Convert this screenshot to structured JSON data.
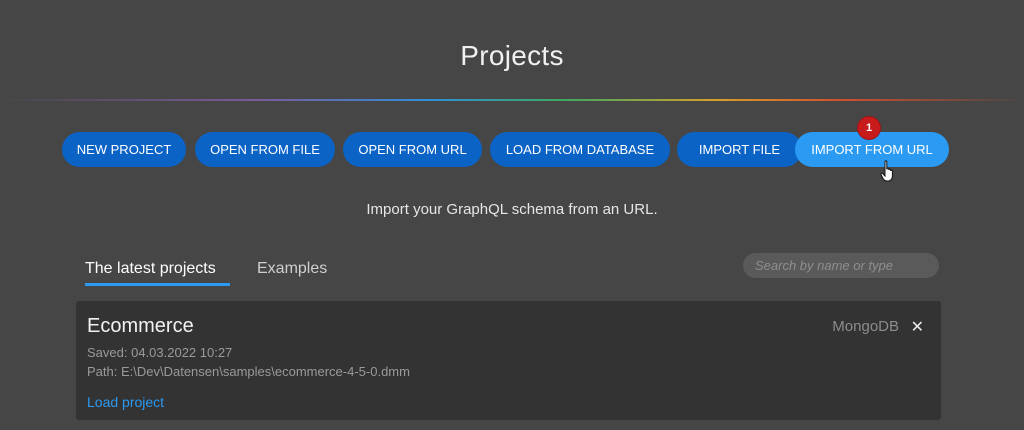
{
  "header": {
    "title": "Projects"
  },
  "toolbar": {
    "buttons": [
      {
        "label": "NEW PROJECT"
      },
      {
        "label": "OPEN FROM FILE"
      },
      {
        "label": "OPEN FROM URL"
      },
      {
        "label": "LOAD FROM DATABASE"
      },
      {
        "label": "IMPORT FILE"
      },
      {
        "label": "IMPORT FROM URL",
        "badge": "1"
      }
    ],
    "accent_color": "#0b63c5",
    "active_color": "#2b9af3",
    "badge_color": "#c81b1b"
  },
  "description": "Import your GraphQL schema from an URL.",
  "tabs": [
    {
      "label": "The latest projects"
    },
    {
      "label": "Examples"
    }
  ],
  "search": {
    "placeholder": "Search by name or type",
    "value": ""
  },
  "project": {
    "name": "Ecommerce",
    "db": "MongoDB",
    "close": "✕",
    "saved": "Saved: 04.03.2022 10:27",
    "path": "Path: E:\\Dev\\Datensen\\samples\\ecommerce-4-5-0.dmm",
    "load_label": "Load project"
  },
  "icons": {
    "cursor": "hand-pointer-icon",
    "close": "close-icon"
  }
}
